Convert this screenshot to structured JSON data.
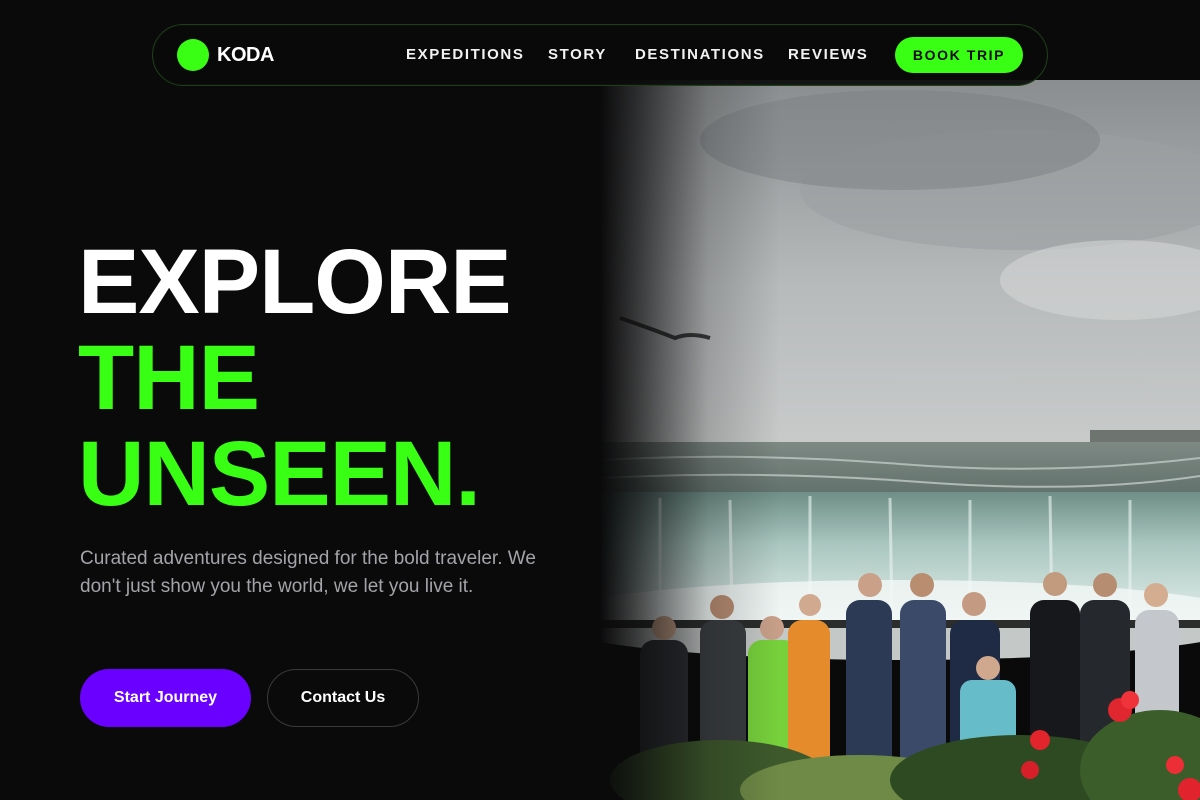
{
  "brand": {
    "name": "KODA",
    "accent_color": "#39ff14",
    "logo_icon": "green-circle-logo"
  },
  "nav": {
    "links": [
      "EXPEDITIONS",
      "STORY",
      "DESTINATIONS",
      "REVIEWS"
    ],
    "cta_label": "BOOK TRIP"
  },
  "hero": {
    "headline": [
      "EXPLORE",
      "THE",
      "UNSEEN."
    ],
    "subtitle": "Curated adventures designed for the bold traveler. We don't just show you the world, we let you live it.",
    "primary_button": "Start Journey",
    "primary_color": "#6a00ff",
    "secondary_button": "Contact Us",
    "image": "waterfall-crowd-photo"
  }
}
